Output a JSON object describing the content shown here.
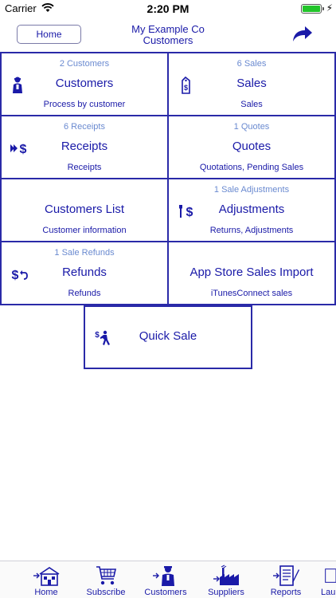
{
  "status": {
    "carrier": "Carrier",
    "time": "2:20 PM"
  },
  "nav": {
    "home_label": "Home",
    "title_line1": "My Example Co",
    "title_line2": "Customers"
  },
  "tiles": [
    {
      "count": "2 Customers",
      "title": "Customers",
      "sub": "Process by customer",
      "icon": "customer-icon"
    },
    {
      "count": "6 Sales",
      "title": "Sales",
      "sub": "Sales",
      "icon": "sales-tag-icon"
    },
    {
      "count": "6 Receipts",
      "title": "Receipts",
      "sub": "Receipts",
      "icon": "receipt-dollar-icon"
    },
    {
      "count": "1 Quotes",
      "title": "Quotes",
      "sub": "Quotations, Pending Sales",
      "icon": ""
    },
    {
      "count": "",
      "title": "Customers List",
      "sub": "Customer information",
      "icon": ""
    },
    {
      "count": "1 Sale Adjustments",
      "title": "Adjustments",
      "sub": "Returns, Adjustments",
      "icon": "adjust-dollar-icon"
    },
    {
      "count": "1 Sale Refunds",
      "title": "Refunds",
      "sub": "Refunds",
      "icon": "refund-dollar-icon"
    },
    {
      "count": "",
      "title": "App Store Sales Import",
      "sub": "iTunesConnect sales",
      "icon": ""
    },
    {
      "count": "",
      "title": "Quick Sale",
      "sub": "",
      "icon": "quick-sale-icon"
    }
  ],
  "tabs": [
    {
      "label": "Home",
      "icon": "house-icon"
    },
    {
      "label": "Subscribe",
      "icon": "cart-icon"
    },
    {
      "label": "Customers",
      "icon": "customer-icon"
    },
    {
      "label": "Suppliers",
      "icon": "factory-icon"
    },
    {
      "label": "Reports",
      "icon": "report-icon"
    },
    {
      "label": "Lau",
      "icon": ""
    }
  ],
  "colors": {
    "accent": "#1a1aa8",
    "count_text": "#6a8ad0",
    "battery": "#22c42a"
  }
}
